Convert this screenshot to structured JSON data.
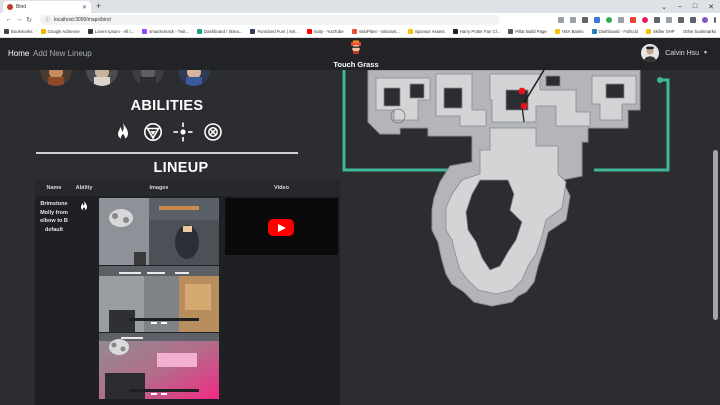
{
  "browser": {
    "tab_title": "Bind",
    "url": "localhost:3000/maps/bind",
    "bookmarks": [
      {
        "label": "Bookmarks",
        "color": "#444444"
      },
      {
        "label": "Google AdSense",
        "color": "#f4b400"
      },
      {
        "label": "Lorem Ipsum - All t...",
        "color": "#333333"
      },
      {
        "label": "smacksmack - Twit...",
        "color": "#9146ff"
      },
      {
        "label": "Dashboard / Strea...",
        "color": "#16a085"
      },
      {
        "label": "FunSized Funt | Sel...",
        "color": "#2c3e50"
      },
      {
        "label": "nutty - YouTube",
        "color": "#ff0000"
      },
      {
        "label": "ValoPlant - Valorant...",
        "color": "#e74c3c"
      },
      {
        "label": "Sponsor Assets",
        "color": "#f1c40f"
      },
      {
        "label": "Harry Potter Fan Cl...",
        "color": "#222222"
      },
      {
        "label": "Pillar Build Page",
        "color": "#555555"
      },
      {
        "label": "HSA Banks",
        "color": "#f1c40f"
      },
      {
        "label": "Dashboard - Fullscid",
        "color": "#2980b9"
      },
      {
        "label": "Skiller SHP",
        "color": "#f1c40f"
      }
    ],
    "other_bookmarks": "Other bookmarks"
  },
  "nav": {
    "home": "Home",
    "add_lineup": "Add New Lineup",
    "brand": "Touch Grass",
    "user_name": "Calvin Hsu"
  },
  "abilities": {
    "title": "ABILITIES",
    "icons": [
      "flame-icon",
      "stim-beacon-icon",
      "sky-smoke-icon",
      "orbital-strike-icon"
    ]
  },
  "lineup": {
    "title": "LINEUP",
    "columns": [
      "Name",
      "Ability",
      "Images",
      "Video"
    ],
    "rows": [
      {
        "name": "Brimstone Molly from elbow to B default",
        "ability_icon": "flame-icon",
        "images": [
          "lineup-screenshot-1",
          "lineup-screenshot-2",
          "lineup-screenshot-3"
        ],
        "video": "youtube-embed"
      }
    ]
  },
  "colors": {
    "accent": "#3fb79a",
    "marker": "#e8121d",
    "header_bg": "#212326",
    "page_bg": "#2b2d30"
  }
}
